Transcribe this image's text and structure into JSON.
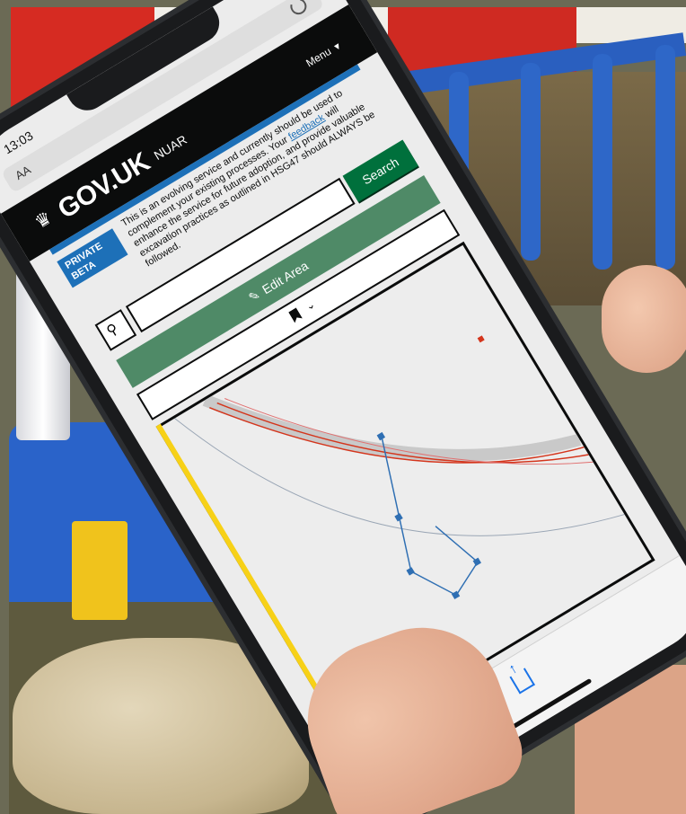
{
  "status": {
    "time": "13:03",
    "aa": "AA"
  },
  "header": {
    "logo": "GOV.UK",
    "service": "NUAR",
    "menu": "Menu"
  },
  "beta": {
    "tag_line1": "PRIVATE",
    "tag_line2": "BETA",
    "text_before": "This is an evolving service and currently should be used to complement your existing processes. Your ",
    "feedback": "feedback",
    "text_after": " will enhance the service for future adoption, and provide valuable excavation practices as outlined in HSG47 should ALWAYS be followed."
  },
  "search": {
    "button": "Search",
    "placeholder": ""
  },
  "edit_area": {
    "label": "Edit Area"
  },
  "icons": [
    "crown-icon",
    "search-icon",
    "pencil-icon",
    "bookmark-icon",
    "chevron-down-icon",
    "back-arrow-icon",
    "forward-arrow-icon",
    "share-icon",
    "reload-icon"
  ],
  "colors": {
    "gov_black": "#0b0c0c",
    "gov_blue": "#1d70b8",
    "gov_green": "#00703c",
    "map_yellow": "#f7d117",
    "pipe_red": "#d4351c",
    "pipe_blue": "#2f6fb3"
  }
}
